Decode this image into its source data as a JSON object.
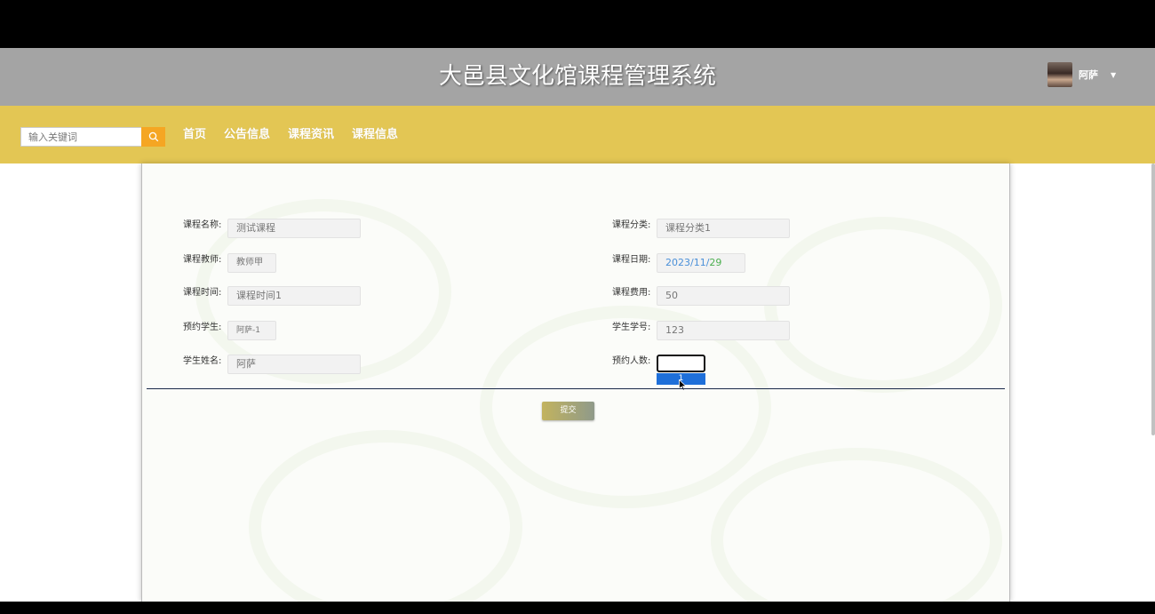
{
  "header": {
    "title": "大邑县文化馆课程管理系统"
  },
  "user": {
    "name": "阿萨"
  },
  "search": {
    "placeholder": "输入关键词"
  },
  "nav": {
    "items": [
      "首页",
      "公告信息",
      "课程资讯",
      "课程信息"
    ]
  },
  "form": {
    "course_name": {
      "label": "课程名称",
      "value": "测试课程"
    },
    "course_category": {
      "label": "课程分类",
      "value": "课程分类1"
    },
    "course_teacher": {
      "label": "课程教师",
      "value": "教师甲"
    },
    "course_date": {
      "label": "课程日期",
      "year_month": "2023/11/",
      "day": "29"
    },
    "course_time": {
      "label": "课程时间",
      "value": "课程时间1"
    },
    "course_fee": {
      "label": "课程费用",
      "value": "50"
    },
    "reserved_student": {
      "label": "预约学生",
      "value": "阿萨-1"
    },
    "student_id": {
      "label": "学生学号",
      "value": "123"
    },
    "student_name": {
      "label": "学生姓名",
      "value": "阿萨"
    },
    "reserve_count": {
      "label": "预约人数",
      "value": "",
      "options": [
        "1"
      ]
    }
  },
  "actions": {
    "submit": "提交"
  }
}
